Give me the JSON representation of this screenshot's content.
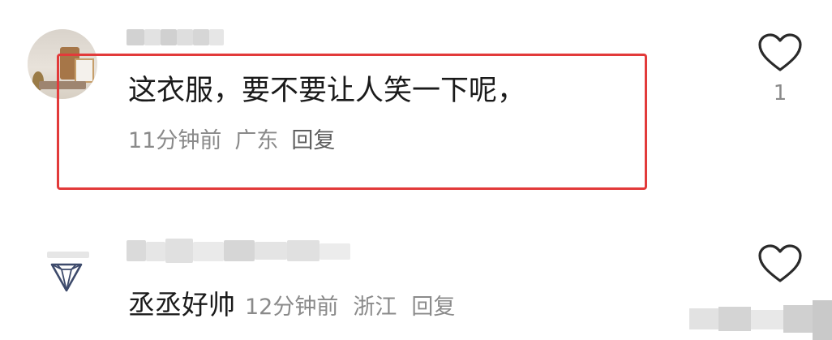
{
  "comments": [
    {
      "text": "这衣服，要不要让人笑一下呢，",
      "time": "11分钟前",
      "location": "广东",
      "reply_label": "回复",
      "likes": "1",
      "avatar_icon": "photo-avatar",
      "like_icon": "heart-outline-icon",
      "highlighted": true,
      "highlight_color": "#e23a3a"
    },
    {
      "text": "丞丞好帅",
      "time": "12分钟前",
      "location": "浙江",
      "reply_label": "回复",
      "avatar_icon": "diamond-icon",
      "like_icon": "heart-outline-icon"
    }
  ],
  "colors": {
    "primary_text": "#1a1a1a",
    "meta_text": "#8a8a8a",
    "highlight": "#e23a3a",
    "background": "#ffffff"
  }
}
